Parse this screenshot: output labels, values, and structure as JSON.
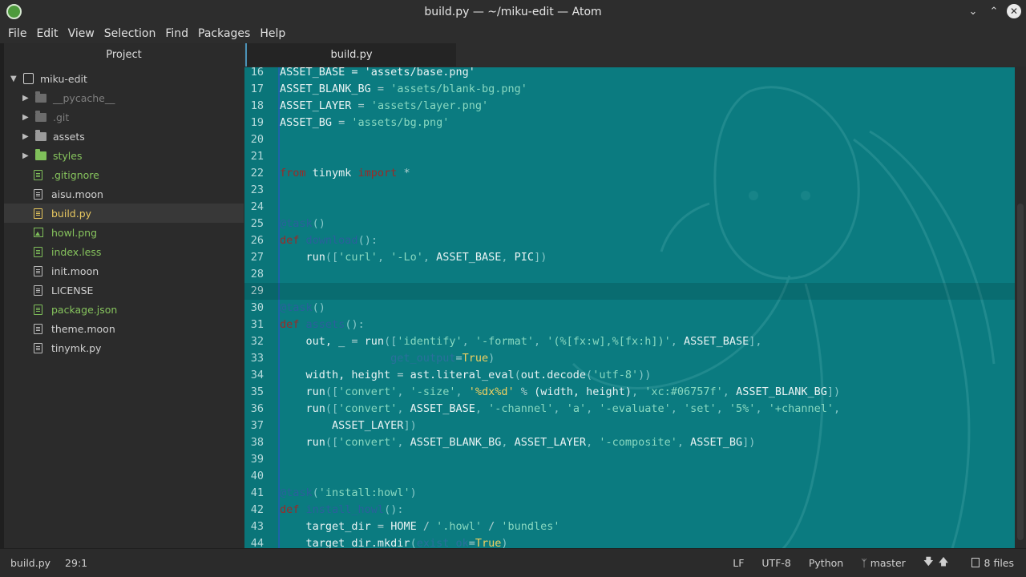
{
  "window": {
    "title": "build.py — ~/miku-edit — Atom"
  },
  "menu": [
    "File",
    "Edit",
    "View",
    "Selection",
    "Find",
    "Packages",
    "Help"
  ],
  "sidebar": {
    "title": "Project",
    "root": "miku-edit",
    "items": [
      {
        "label": "__pycache__",
        "kind": "dir",
        "color": "dim"
      },
      {
        "label": ".git",
        "kind": "dir",
        "color": "dim"
      },
      {
        "label": "assets",
        "kind": "dir",
        "color": "normal"
      },
      {
        "label": "styles",
        "kind": "dir",
        "color": "green"
      },
      {
        "label": ".gitignore",
        "kind": "file",
        "color": "green"
      },
      {
        "label": "aisu.moon",
        "kind": "file",
        "color": "normal"
      },
      {
        "label": "build.py",
        "kind": "file",
        "color": "yellow",
        "selected": true
      },
      {
        "label": "howl.png",
        "kind": "image",
        "color": "green"
      },
      {
        "label": "index.less",
        "kind": "file",
        "color": "green"
      },
      {
        "label": "init.moon",
        "kind": "file",
        "color": "normal"
      },
      {
        "label": "LICENSE",
        "kind": "file",
        "color": "normal"
      },
      {
        "label": "package.json",
        "kind": "file",
        "color": "green"
      },
      {
        "label": "theme.moon",
        "kind": "file",
        "color": "normal"
      },
      {
        "label": "tinymk.py",
        "kind": "file",
        "color": "normal"
      }
    ]
  },
  "tabs": [
    {
      "label": "build.py",
      "active": true
    }
  ],
  "editor": {
    "cursor_line": 29,
    "lines": [
      {
        "n": "16",
        "t": [
          [
            "ASSET_BASE = 'assets/base.png'",
            ""
          ]
        ]
      },
      {
        "n": "17",
        "t": [
          [
            "ASSET_BLANK_BG ",
            ""
          ],
          [
            "=",
            "op"
          ],
          [
            " 'assets/blank-bg.png'",
            "str"
          ]
        ]
      },
      {
        "n": "18",
        "t": [
          [
            "ASSET_LAYER ",
            ""
          ],
          [
            "=",
            "op"
          ],
          [
            " 'assets/layer.png'",
            "str"
          ]
        ]
      },
      {
        "n": "19",
        "t": [
          [
            "ASSET_BG ",
            ""
          ],
          [
            "=",
            "op"
          ],
          [
            " 'assets/bg.png'",
            "str"
          ]
        ]
      },
      {
        "n": "20",
        "t": []
      },
      {
        "n": "21",
        "t": []
      },
      {
        "n": "22",
        "t": [
          [
            "from",
            "kw"
          ],
          [
            " tinymk ",
            ""
          ],
          [
            "import",
            "kw"
          ],
          [
            " *",
            "op"
          ]
        ]
      },
      {
        "n": "23",
        "t": []
      },
      {
        "n": "24",
        "t": []
      },
      {
        "n": "25",
        "t": [
          [
            "@task",
            "dec"
          ],
          [
            "()",
            "punc"
          ]
        ]
      },
      {
        "n": "26",
        "t": [
          [
            "def",
            "kw"
          ],
          [
            " ",
            ""
          ],
          [
            "download",
            "fn"
          ],
          [
            "():",
            "punc"
          ]
        ]
      },
      {
        "n": "27",
        "t": [
          [
            "    run",
            ""
          ],
          [
            "([",
            "punc"
          ],
          [
            "'curl'",
            "str"
          ],
          [
            ", ",
            "punc"
          ],
          [
            "'-Lo'",
            "str"
          ],
          [
            ", ",
            "punc"
          ],
          [
            "ASSET_BASE",
            ""
          ],
          [
            ", ",
            "punc"
          ],
          [
            "PIC",
            ""
          ],
          [
            "])",
            "punc"
          ]
        ]
      },
      {
        "n": "28",
        "t": []
      },
      {
        "n": "29",
        "t": []
      },
      {
        "n": "30",
        "t": [
          [
            "@task",
            "dec"
          ],
          [
            "()",
            "punc"
          ]
        ]
      },
      {
        "n": "31",
        "t": [
          [
            "def",
            "kw"
          ],
          [
            " ",
            ""
          ],
          [
            "assets",
            "fn"
          ],
          [
            "():",
            "punc"
          ]
        ]
      },
      {
        "n": "32",
        "t": [
          [
            "    out, _ ",
            ""
          ],
          [
            "=",
            "op"
          ],
          [
            " run",
            ""
          ],
          [
            "([",
            "punc"
          ],
          [
            "'identify'",
            "str"
          ],
          [
            ", ",
            "punc"
          ],
          [
            "'-format'",
            "str"
          ],
          [
            ", ",
            "punc"
          ],
          [
            "'(%[fx:w],%[fx:h])'",
            "str"
          ],
          [
            ", ",
            "punc"
          ],
          [
            "ASSET_BASE",
            ""
          ],
          [
            "],",
            "punc"
          ]
        ]
      },
      {
        "n": "33",
        "t": [
          [
            "                 ",
            ""
          ],
          [
            "get_output",
            "param"
          ],
          [
            "=",
            "op"
          ],
          [
            "True",
            "bool"
          ],
          [
            ")",
            "punc"
          ]
        ]
      },
      {
        "n": "34",
        "t": [
          [
            "    width, height ",
            ""
          ],
          [
            "=",
            "op"
          ],
          [
            " ast.literal_eval",
            ""
          ],
          [
            "(",
            "punc"
          ],
          [
            "out.decode",
            ""
          ],
          [
            "(",
            "punc"
          ],
          [
            "'utf-8'",
            "str"
          ],
          [
            "))",
            "punc"
          ]
        ]
      },
      {
        "n": "35",
        "t": [
          [
            "    run",
            ""
          ],
          [
            "([",
            "punc"
          ],
          [
            "'convert'",
            "str"
          ],
          [
            ", ",
            "punc"
          ],
          [
            "'-size'",
            "str"
          ],
          [
            ", ",
            "punc"
          ],
          [
            "'%dx%d'",
            "bool"
          ],
          [
            " % ",
            "op"
          ],
          [
            "(width, height)",
            ""
          ],
          [
            ", ",
            "punc"
          ],
          [
            "'xc:#06757f'",
            "str"
          ],
          [
            ", ",
            "punc"
          ],
          [
            "ASSET_BLANK_BG",
            ""
          ],
          [
            "])",
            "punc"
          ]
        ]
      },
      {
        "n": "36",
        "t": [
          [
            "    run",
            ""
          ],
          [
            "([",
            "punc"
          ],
          [
            "'convert'",
            "str"
          ],
          [
            ", ",
            "punc"
          ],
          [
            "ASSET_BASE",
            ""
          ],
          [
            ", ",
            "punc"
          ],
          [
            "'-channel'",
            "str"
          ],
          [
            ", ",
            "punc"
          ],
          [
            "'a'",
            "str"
          ],
          [
            ", ",
            "punc"
          ],
          [
            "'-evaluate'",
            "str"
          ],
          [
            ", ",
            "punc"
          ],
          [
            "'set'",
            "str"
          ],
          [
            ", ",
            "punc"
          ],
          [
            "'5%'",
            "str"
          ],
          [
            ", ",
            "punc"
          ],
          [
            "'+channel'",
            "str"
          ],
          [
            ",",
            "punc"
          ]
        ]
      },
      {
        "n": "37",
        "t": [
          [
            "        ASSET_LAYER",
            ""
          ],
          [
            "])",
            "punc"
          ]
        ]
      },
      {
        "n": "38",
        "t": [
          [
            "    run",
            ""
          ],
          [
            "([",
            "punc"
          ],
          [
            "'convert'",
            "str"
          ],
          [
            ", ",
            "punc"
          ],
          [
            "ASSET_BLANK_BG",
            ""
          ],
          [
            ", ",
            "punc"
          ],
          [
            "ASSET_LAYER",
            ""
          ],
          [
            ", ",
            "punc"
          ],
          [
            "'-composite'",
            "str"
          ],
          [
            ", ",
            "punc"
          ],
          [
            "ASSET_BG",
            ""
          ],
          [
            "])",
            "punc"
          ]
        ]
      },
      {
        "n": "39",
        "t": []
      },
      {
        "n": "40",
        "t": []
      },
      {
        "n": "41",
        "t": [
          [
            "@task",
            "dec"
          ],
          [
            "(",
            "punc"
          ],
          [
            "'install:howl'",
            "str"
          ],
          [
            ")",
            "punc"
          ]
        ]
      },
      {
        "n": "42",
        "t": [
          [
            "def",
            "kw"
          ],
          [
            " ",
            ""
          ],
          [
            "install_howl",
            "fn"
          ],
          [
            "():",
            "punc"
          ]
        ]
      },
      {
        "n": "43",
        "t": [
          [
            "    target_dir ",
            ""
          ],
          [
            "=",
            "op"
          ],
          [
            " HOME ",
            ""
          ],
          [
            "/",
            "op"
          ],
          [
            " '.howl'",
            "str"
          ],
          [
            " / ",
            "op"
          ],
          [
            "'bundles'",
            "str"
          ]
        ]
      },
      {
        "n": "44",
        "t": [
          [
            "    target_dir.mkdir",
            ""
          ],
          [
            "(",
            "punc"
          ],
          [
            "exist_ok",
            "param"
          ],
          [
            "=",
            "op"
          ],
          [
            "True",
            "bool"
          ],
          [
            ")",
            "punc"
          ]
        ]
      }
    ]
  },
  "status": {
    "file": "build.py",
    "position": "29:1",
    "line_ending": "LF",
    "encoding": "UTF-8",
    "grammar": "Python",
    "branch": "master",
    "files": "8 files"
  },
  "colors": {
    "editor_bg": "#0b7b80",
    "keyword": "#9c2a26",
    "string": "#88d8c0",
    "function": "#2b5f9c"
  }
}
